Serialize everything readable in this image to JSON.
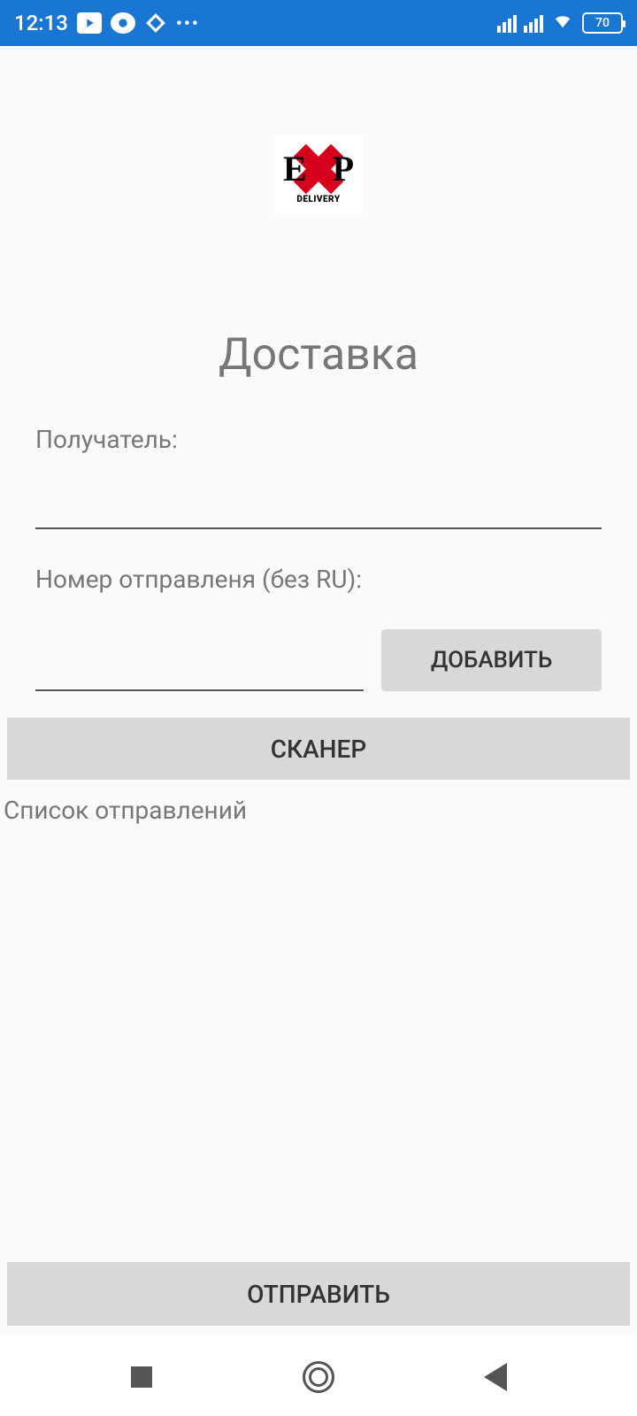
{
  "status_bar": {
    "time": "12:13",
    "battery_pct": "70"
  },
  "logo": {
    "letter_left": "E",
    "letter_right": "P",
    "subtitle": "DELIVERY"
  },
  "page": {
    "title": "Доставка"
  },
  "form": {
    "recipient_label": "Получатель:",
    "recipient_value": "",
    "shipment_label": "Номер отправленя (без RU):",
    "shipment_value": "",
    "add_button": "ДОБАВИТЬ",
    "scanner_button": "СКАНЕР",
    "list_header": "Список отправлений",
    "submit_button": "ОТПРАВИТЬ"
  }
}
